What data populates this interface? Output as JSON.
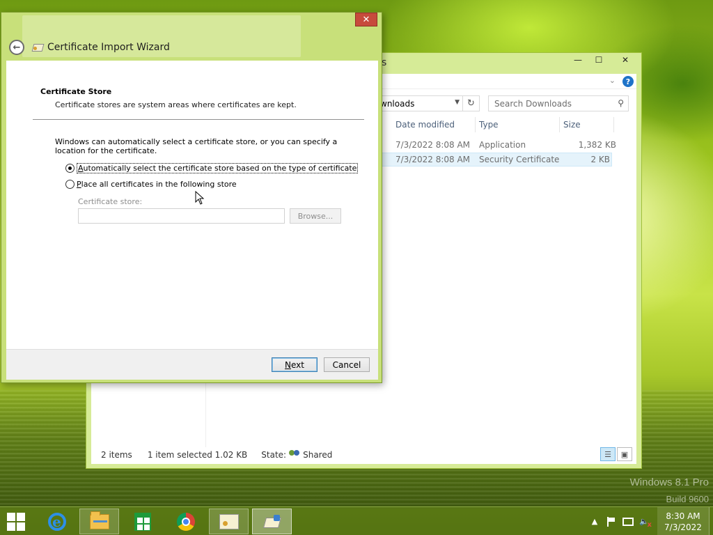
{
  "desktop": {
    "watermark_line1": "Windows 8.1 Pro",
    "watermark_line2": "Build 9600"
  },
  "explorer": {
    "title_fragment": "s",
    "window_controls": {
      "minimize": "—",
      "maximize": "☐",
      "close": "✕"
    },
    "help_label": "?",
    "address_text": "wnloads",
    "search_placeholder": "Search Downloads",
    "columns": [
      "Date modified",
      "Type",
      "Size"
    ],
    "files": [
      {
        "date": "7/3/2022 8:08 AM",
        "type": "Application",
        "size": "1,382 KB",
        "selected": false
      },
      {
        "date": "7/3/2022 8:08 AM",
        "type": "Security Certificate",
        "size": "2 KB",
        "selected": true
      }
    ],
    "status": {
      "items": "2 items",
      "selection": "1 item selected  1.02 KB",
      "state_label": "State:",
      "state_value": "Shared"
    }
  },
  "wizard": {
    "title": "Certificate Import Wizard",
    "close_label": "✕",
    "page_title": "Certificate Store",
    "page_desc": "Certificate stores are system areas where certificates are kept.",
    "intro": "Windows can automatically select a certificate store, or you can specify a location for the certificate.",
    "option_auto": {
      "mnemonic": "A",
      "rest": "utomatically select the certificate store based on the type of certificate",
      "checked": true
    },
    "option_place": {
      "mnemonic": "P",
      "rest": "lace all certificates in the following store",
      "checked": false
    },
    "store_label": "Certificate store:",
    "store_value": "",
    "browse_label": "Browse...",
    "next_mnemonic": "N",
    "next_rest": "ext",
    "cancel_label": "Cancel"
  },
  "taskbar": {
    "apps": [
      "internet-explorer",
      "file-explorer",
      "store",
      "chrome",
      "certificate",
      "certificate-import-wizard"
    ],
    "clock_time": "8:30 AM",
    "clock_date": "7/3/2022",
    "tray_up_arrow": "▲"
  }
}
